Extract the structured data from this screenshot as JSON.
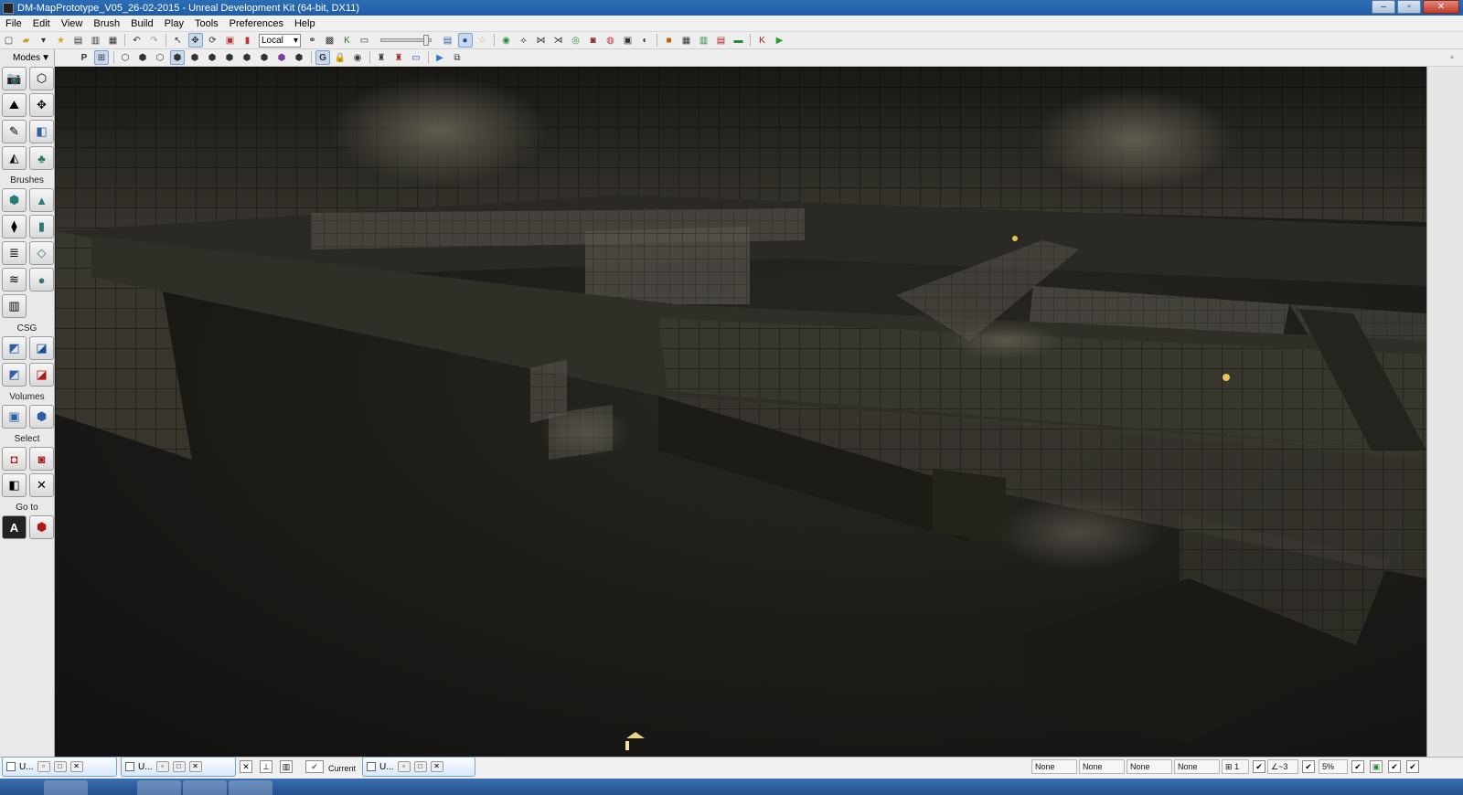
{
  "window": {
    "title": "DM-MapPrototype_V05_26-02-2015 - Unreal Development Kit (64-bit, DX11)",
    "controls": [
      "–",
      "▫",
      "✕"
    ]
  },
  "menu": [
    "File",
    "Edit",
    "View",
    "Brush",
    "Build",
    "Play",
    "Tools",
    "Preferences",
    "Help"
  ],
  "toolbar": {
    "coord_system": "Local"
  },
  "modes_panel": {
    "title": "Modes",
    "sections": {
      "brushes": "Brushes",
      "csg": "CSG",
      "volumes": "Volumes",
      "select": "Select",
      "goto": "Go to"
    },
    "goto_label_a": "A",
    "toolbar2_labels": {
      "p": "P",
      "g": "G"
    }
  },
  "status": {
    "current_label": "Current",
    "fields": [
      "None",
      "None",
      "None",
      "None"
    ],
    "grid_value": "1",
    "rot_value": "~3",
    "scale_value": "5%"
  },
  "minimized_windows": [
    {
      "label": "U..."
    },
    {
      "label": "U..."
    },
    {
      "label": "U..."
    }
  ],
  "colors": {
    "titlebar": "#1f5ea8",
    "viewport_bg": "#1b1a17",
    "tile": "#3a382f"
  }
}
